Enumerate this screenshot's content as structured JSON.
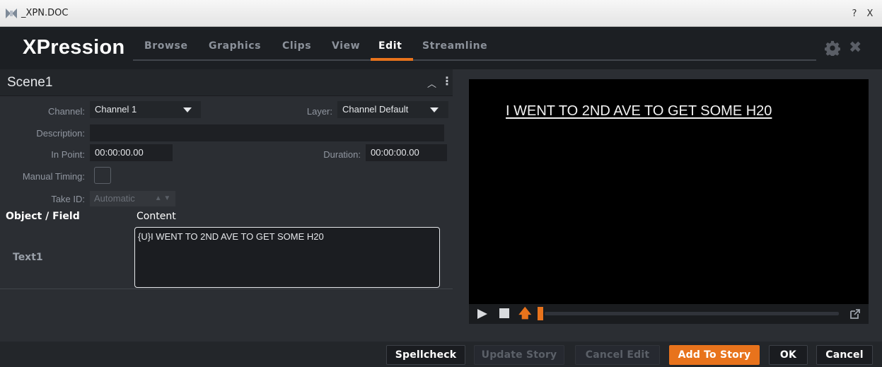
{
  "window": {
    "title": "_XPN.DOC",
    "help_label": "?",
    "close_label": "X"
  },
  "app": {
    "brand": "XPression",
    "tabs": [
      {
        "label": "Browse",
        "active": false
      },
      {
        "label": "Graphics",
        "active": false
      },
      {
        "label": "Clips",
        "active": false
      },
      {
        "label": "View",
        "active": false
      },
      {
        "label": "Edit",
        "active": true
      },
      {
        "label": "Streamline",
        "active": false
      }
    ],
    "accent_color": "#e8731c",
    "settings_icon": "gear-icon",
    "close_icon": "close-icon"
  },
  "scene": {
    "name": "Scene1",
    "collapse_icon": "chevron-up-icon",
    "menu_icon": "kebab-menu-icon",
    "channel_label": "Channel:",
    "channel_value": "Channel 1",
    "layer_label": "Layer:",
    "layer_value": "Channel Default",
    "description_label": "Description:",
    "description_value": "",
    "inpoint_label": "In Point:",
    "inpoint_value": "00:00:00.00",
    "duration_label": "Duration:",
    "duration_value": "00:00:00.00",
    "manual_timing_label": "Manual Timing:",
    "manual_timing_checked": false,
    "takeid_label": "Take ID:",
    "takeid_value": "Automatic"
  },
  "fields_table": {
    "headers": {
      "object": "Object / Field",
      "content": "Content"
    },
    "rows": [
      {
        "object": "Text1",
        "content": "{U}I WENT TO 2ND AVE TO GET SOME H20"
      }
    ]
  },
  "preview": {
    "text": "I WENT TO 2ND AVE TO GET SOME H20",
    "controls": [
      "play-icon",
      "stop-icon",
      "take-arrow-icon",
      "popout-icon"
    ]
  },
  "actions": {
    "spellcheck": "Spellcheck",
    "update_story": "Update Story",
    "cancel_edit": "Cancel Edit",
    "add_to_story": "Add To Story",
    "ok": "OK",
    "cancel": "Cancel"
  }
}
